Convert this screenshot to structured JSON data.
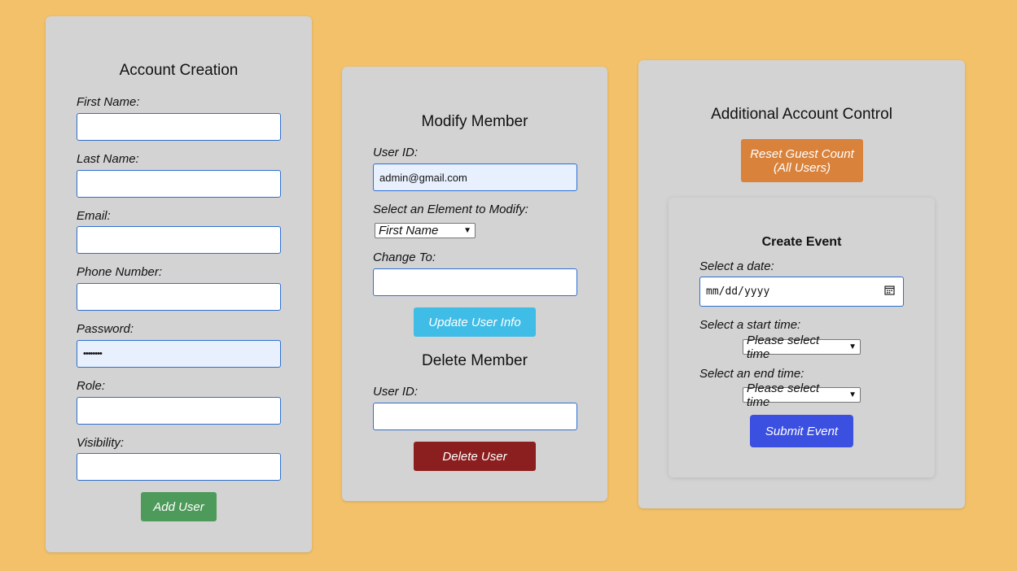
{
  "account_creation": {
    "title": "Account Creation",
    "fields": [
      {
        "label": "First Name:",
        "value": ""
      },
      {
        "label": "Last Name:",
        "value": ""
      },
      {
        "label": "Email:",
        "value": ""
      },
      {
        "label": "Phone Number:",
        "value": ""
      },
      {
        "label": "Password:",
        "value": "••••••••"
      },
      {
        "label": "Role:",
        "value": ""
      },
      {
        "label": "Visibility:",
        "value": ""
      }
    ],
    "add_button": "Add User"
  },
  "modify_member": {
    "title": "Modify Member",
    "user_id_label": "User ID:",
    "user_id_value": "admin@gmail.com",
    "element_label": "Select an Element to Modify:",
    "element_selected": "First Name",
    "change_label": "Change To:",
    "change_value": "",
    "update_button": "Update User Info"
  },
  "delete_member": {
    "title": "Delete Member",
    "user_id_label": "User ID:",
    "user_id_value": "",
    "delete_button": "Delete User"
  },
  "additional_control": {
    "title": "Additional Account Control",
    "reset_button_line1": "Reset Guest Count",
    "reset_button_line2": "(All Users)"
  },
  "create_event": {
    "title": "Create Event",
    "date_label": "Select a date:",
    "date_placeholder": "mm/dd/yyyy",
    "start_label": "Select a start time:",
    "start_selected": "Please select time",
    "end_label": "Select an end time:",
    "end_selected": "Please select time",
    "submit_button": "Submit Event"
  },
  "colors": {
    "background": "#f3c16a",
    "card": "#d3d3d3",
    "add_user": "#4e9a5b",
    "update_user": "#3fbde6",
    "delete_user": "#8b1e1e",
    "reset_guest": "#d9823b",
    "submit_event": "#3b4fe0"
  }
}
